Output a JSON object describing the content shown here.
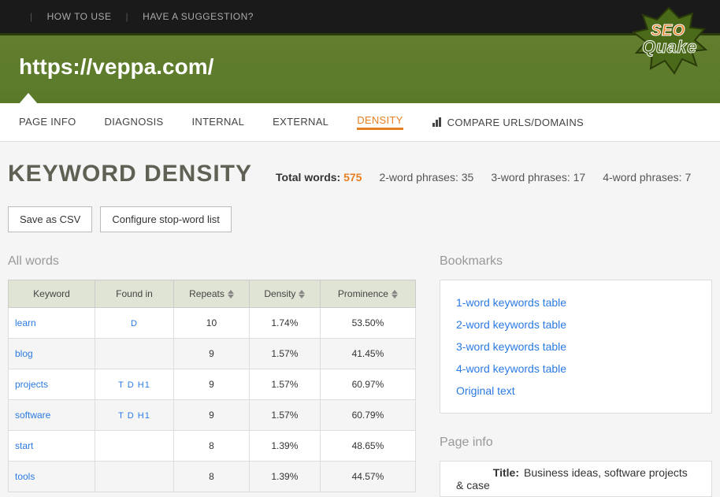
{
  "topbar": {
    "how_to_use": "HOW TO USE",
    "suggestion": "HAVE A SUGGESTION?"
  },
  "logo": {
    "brand_top": "SEO",
    "brand_bottom": "Quake"
  },
  "header": {
    "url": "https://veppa.com/"
  },
  "tabs": {
    "page_info": "PAGE INFO",
    "diagnosis": "DIAGNOSIS",
    "internal": "INTERNAL",
    "external": "EXTERNAL",
    "density": "DENSITY",
    "compare": "COMPARE URLS/DOMAINS"
  },
  "page_title": "KEYWORD DENSITY",
  "stats": {
    "total_words_label": "Total words:",
    "total_words": "575",
    "two_word_label": "2-word phrases:",
    "two_word": "35",
    "three_word_label": "3-word phrases:",
    "three_word": "17",
    "four_word_label": "4-word phrases:",
    "four_word": "7"
  },
  "buttons": {
    "save_csv": "Save as CSV",
    "configure": "Configure stop-word list"
  },
  "table": {
    "title": "All words",
    "headers": {
      "keyword": "Keyword",
      "found_in": "Found in",
      "repeats": "Repeats",
      "density": "Density",
      "prominence": "Prominence"
    },
    "rows": [
      {
        "keyword": "learn",
        "found_in": "D",
        "repeats": "10",
        "density": "1.74%",
        "prominence": "53.50%"
      },
      {
        "keyword": "blog",
        "found_in": "",
        "repeats": "9",
        "density": "1.57%",
        "prominence": "41.45%"
      },
      {
        "keyword": "projects",
        "found_in": "T  D  H1",
        "repeats": "9",
        "density": "1.57%",
        "prominence": "60.97%"
      },
      {
        "keyword": "software",
        "found_in": "T  D  H1",
        "repeats": "9",
        "density": "1.57%",
        "prominence": "60.79%"
      },
      {
        "keyword": "start",
        "found_in": "",
        "repeats": "8",
        "density": "1.39%",
        "prominence": "48.65%"
      },
      {
        "keyword": "tools",
        "found_in": "",
        "repeats": "8",
        "density": "1.39%",
        "prominence": "44.57%"
      }
    ]
  },
  "bookmarks": {
    "title": "Bookmarks",
    "items": [
      "1-word keywords table",
      "2-word keywords table",
      "3-word keywords table",
      "4-word keywords table",
      "Original text"
    ]
  },
  "pageinfo": {
    "title": "Page info",
    "title_label": "Title:",
    "title_value": "Business ideas, software projects & case"
  }
}
